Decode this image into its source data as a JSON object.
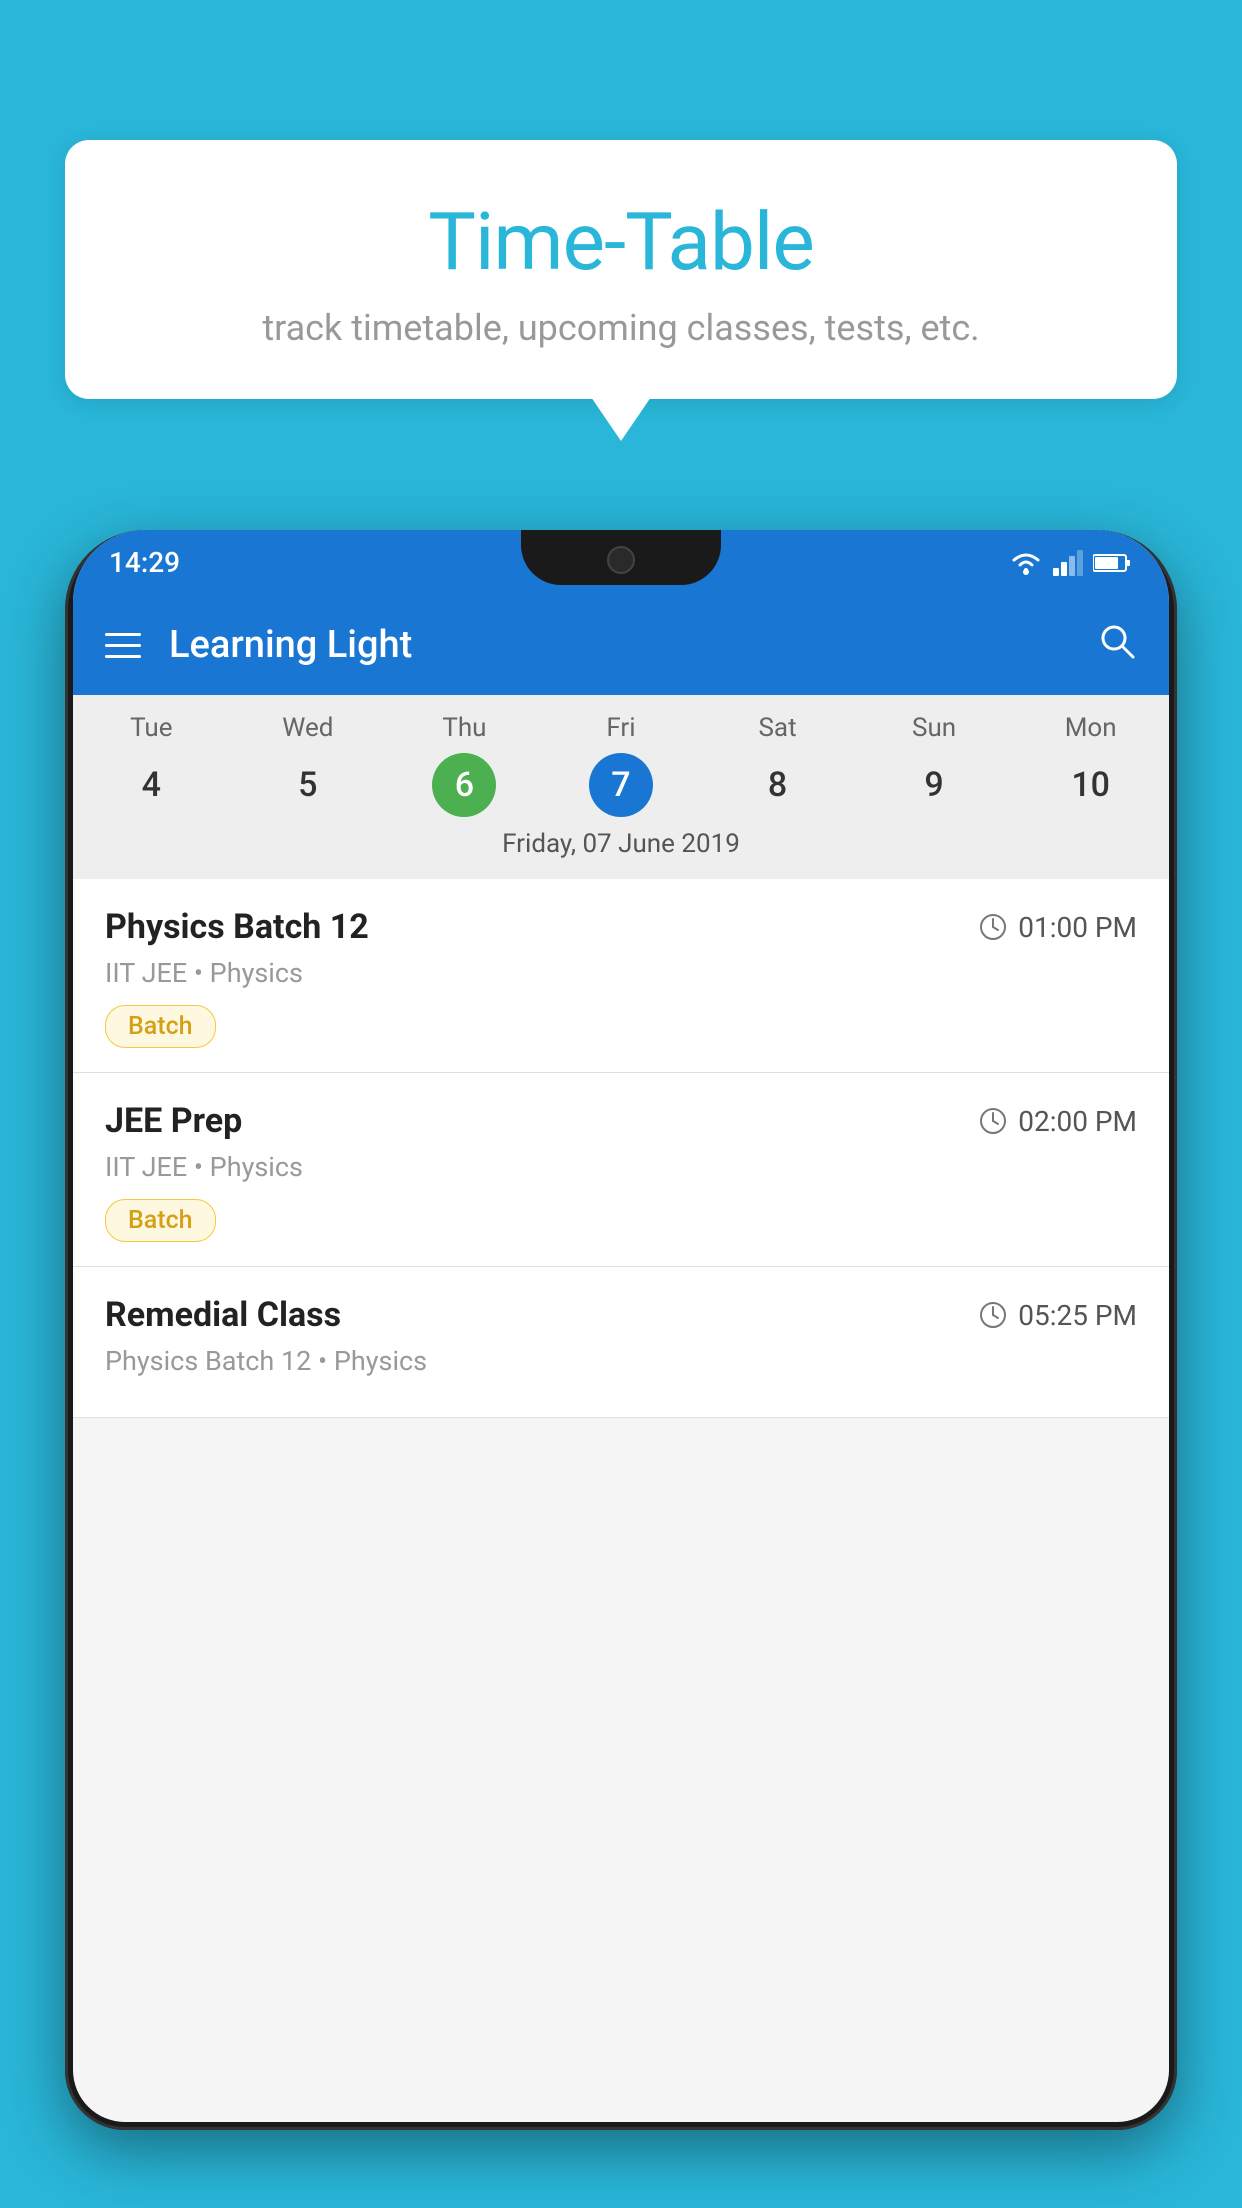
{
  "background_color": "#29b6d8",
  "bubble": {
    "title": "Time-Table",
    "subtitle": "track timetable, upcoming classes, tests, etc."
  },
  "status_bar": {
    "time": "14:29"
  },
  "app_bar": {
    "title": "Learning Light"
  },
  "calendar": {
    "days": [
      {
        "label": "Tue",
        "number": "4"
      },
      {
        "label": "Wed",
        "number": "5"
      },
      {
        "label": "Thu",
        "number": "6",
        "state": "today"
      },
      {
        "label": "Fri",
        "number": "7",
        "state": "selected"
      },
      {
        "label": "Sat",
        "number": "8"
      },
      {
        "label": "Sun",
        "number": "9"
      },
      {
        "label": "Mon",
        "number": "10"
      }
    ],
    "selected_date": "Friday, 07 June 2019"
  },
  "schedule": [
    {
      "title": "Physics Batch 12",
      "time": "01:00 PM",
      "sub": "IIT JEE • Physics",
      "badge": "Batch"
    },
    {
      "title": "JEE Prep",
      "time": "02:00 PM",
      "sub": "IIT JEE • Physics",
      "badge": "Batch"
    },
    {
      "title": "Remedial Class",
      "time": "05:25 PM",
      "sub": "Physics Batch 12 • Physics",
      "badge": null
    }
  ]
}
